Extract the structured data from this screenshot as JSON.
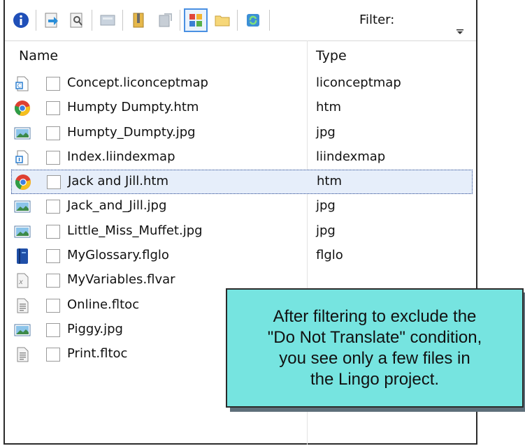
{
  "toolbar": {
    "filter_label": "Filter:",
    "buttons": [
      "info-icon",
      "open-icon",
      "preview-icon",
      "edit-icon",
      "zip-icon",
      "export-icon",
      "view-icon",
      "folder-icon",
      "refresh-icon"
    ]
  },
  "columns": {
    "name": "Name",
    "type": "Type"
  },
  "files": [
    {
      "name": "Concept.liconceptmap",
      "type": "liconceptmap",
      "icon": "concept-map-icon"
    },
    {
      "name": "Humpty Dumpty.htm",
      "type": "htm",
      "icon": "chrome-icon"
    },
    {
      "name": "Humpty_Dumpty.jpg",
      "type": "jpg",
      "icon": "image-icon"
    },
    {
      "name": "Index.liindexmap",
      "type": "liindexmap",
      "icon": "index-map-icon"
    },
    {
      "name": "Jack and Jill.htm",
      "type": "htm",
      "icon": "chrome-icon"
    },
    {
      "name": "Jack_and_Jill.jpg",
      "type": "jpg",
      "icon": "image-icon"
    },
    {
      "name": "Little_Miss_Muffet.jpg",
      "type": "jpg",
      "icon": "image-icon"
    },
    {
      "name": "MyGlossary.flglo",
      "type": "flglo",
      "icon": "glossary-icon"
    },
    {
      "name": "MyVariables.flvar",
      "type": "",
      "icon": "variables-icon"
    },
    {
      "name": "Online.fltoc",
      "type": "",
      "icon": "toc-icon"
    },
    {
      "name": "Piggy.jpg",
      "type": "",
      "icon": "image-icon"
    },
    {
      "name": "Print.fltoc",
      "type": "",
      "icon": "toc-icon"
    }
  ],
  "callout": {
    "text": "After filtering to exclude the\n\"Do Not Translate\" condition,\nyou see only a few files in\nthe Lingo project."
  }
}
